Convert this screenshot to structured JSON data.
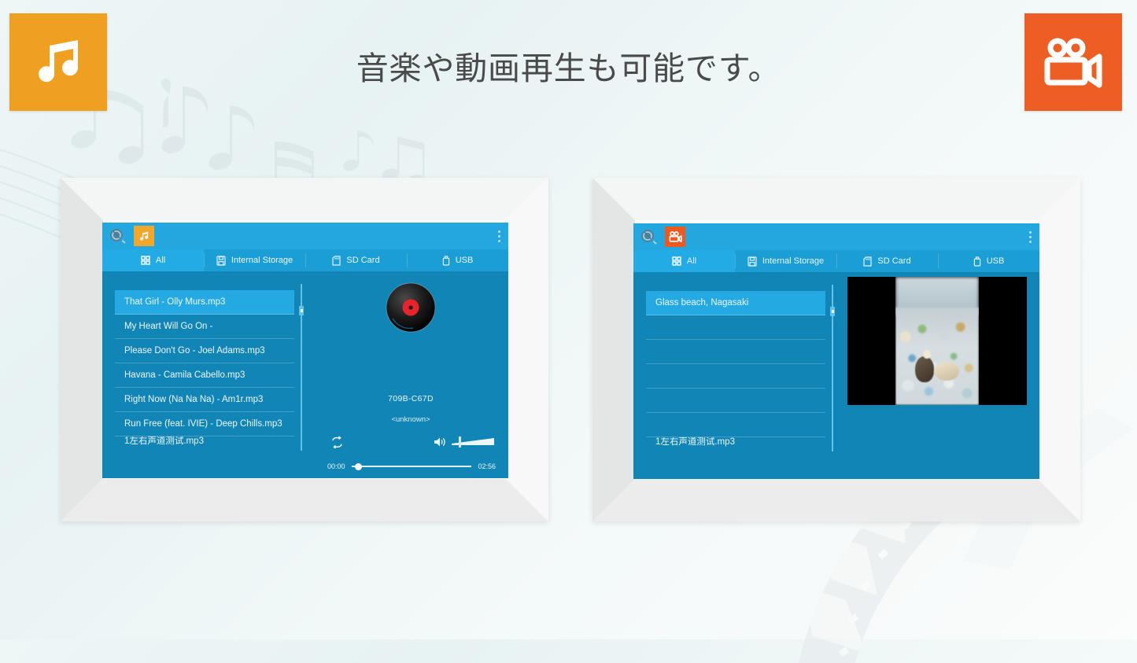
{
  "headline": "音楽や動画再生も可能です。",
  "corner_tiles": {
    "music": {
      "icon": "music-note-icon",
      "color": "#f0a021"
    },
    "video": {
      "icon": "movie-camera-icon",
      "color": "#ec5e24"
    }
  },
  "theme": {
    "appbar": "#23a7de",
    "tabbar": "#1b9ed4",
    "content": "#1185b5",
    "selected_row": "#24a9e2",
    "music_accent": "#f2a72c",
    "video_accent": "#ec5a22"
  },
  "tabs": [
    {
      "label": "All",
      "icon": "grid-icon",
      "active": true
    },
    {
      "label": "Internal Storage",
      "icon": "internal-storage-icon",
      "active": false
    },
    {
      "label": "SD Card",
      "icon": "sd-card-icon",
      "active": false
    },
    {
      "label": "USB",
      "icon": "usb-drive-icon",
      "active": false
    }
  ],
  "music_player": {
    "mode_icon": "music-note-icon",
    "logo_icon": "app-logo-icon",
    "overflow_icon": "overflow-menu-icon",
    "playlist": [
      {
        "label": "That Girl - Olly Murs.mp3",
        "selected": true
      },
      {
        "label": "My Heart Will Go On -",
        "selected": false
      },
      {
        "label": "Please Don't Go - Joel Adams.mp3",
        "selected": false
      },
      {
        "label": "Havana - Camila Cabello.mp3",
        "selected": false
      },
      {
        "label": "Right Now (Na Na Na) - Am1r.mp3",
        "selected": false
      },
      {
        "label": "Run Free (feat. IVIE) - Deep Chills.mp3",
        "selected": false
      },
      {
        "label": "1左右声道测试.mp3",
        "selected": false
      }
    ],
    "now_playing": {
      "title": "709B-C67D",
      "artist": "<unknown>",
      "elapsed": "00:00",
      "duration": "02:56",
      "progress_percent": 3,
      "volume_percent": 18
    },
    "controls": {
      "repeat": "repeat-icon",
      "volume": "volume-icon",
      "previous": "previous-track-button",
      "play": "play-button",
      "next": "next-track-button"
    }
  },
  "video_player": {
    "mode_icon": "movie-camera-icon",
    "logo_icon": "app-logo-icon",
    "overflow_icon": "overflow-menu-icon",
    "playlist": [
      {
        "label": "Glass beach, Nagasaki",
        "selected": true
      },
      {
        "label": "",
        "selected": false
      },
      {
        "label": "",
        "selected": false
      },
      {
        "label": "",
        "selected": false
      },
      {
        "label": "",
        "selected": false
      },
      {
        "label": "",
        "selected": false
      },
      {
        "label": "1左右声道测试.mp3",
        "selected": false
      }
    ],
    "preview": {
      "caption": "Glass beach, Nagasaki",
      "aspect": "portrait-pillarboxed"
    }
  }
}
